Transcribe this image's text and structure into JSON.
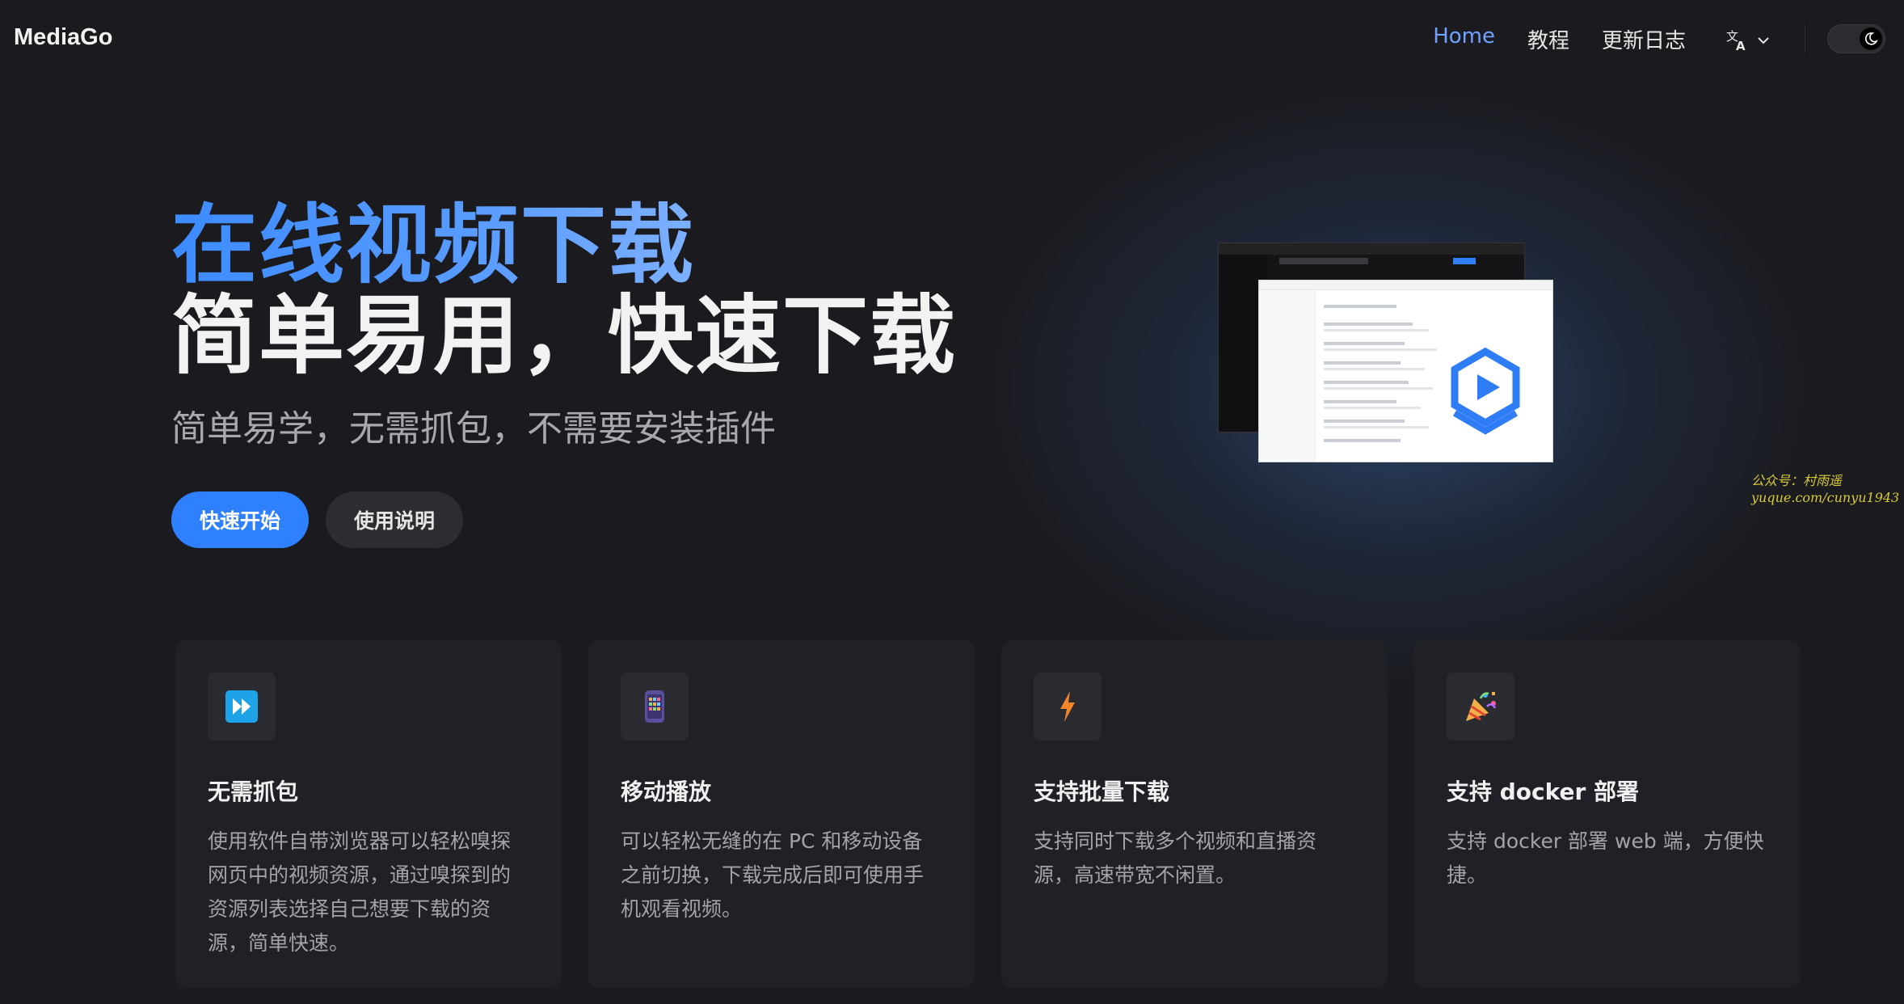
{
  "nav": {
    "brand": "MediaGo",
    "links": [
      "Home",
      "教程",
      "更新日志"
    ],
    "language_icon": "translate-icon",
    "theme_icon": "moon-icon"
  },
  "hero": {
    "title_line1": "在线视频下载",
    "title_line2": "简单易用，快速下载",
    "subtitle": "简单易学，无需抓包，不需要安装插件",
    "primary_button": "快速开始",
    "secondary_button": "使用说明"
  },
  "watermark": {
    "line1": "公众号：村雨遥",
    "line2": "yuque.com/cunyu1943"
  },
  "features": [
    {
      "icon": "fast-forward-icon",
      "title": "无需抓包",
      "description": "使用软件自带浏览器可以轻松嗅探网页中的视频资源，通过嗅探到的资源列表选择自己想要下载的资源，简单快速。"
    },
    {
      "icon": "mobile-phone-icon",
      "title": "移动播放",
      "description": "可以轻松无缝的在 PC 和移动设备之前切换，下载完成后即可使用手机观看视频。"
    },
    {
      "icon": "lightning-icon",
      "title": "支持批量下载",
      "description": "支持同时下载多个视频和直播资源，高速带宽不闲置。"
    },
    {
      "icon": "party-popper-icon",
      "title": "支持 docker 部署",
      "description": "支持 docker 部署 web 端，方便快捷。"
    }
  ],
  "colors": {
    "accent": "#2f80ff",
    "background": "#1b1b1f",
    "card": "#202127"
  }
}
